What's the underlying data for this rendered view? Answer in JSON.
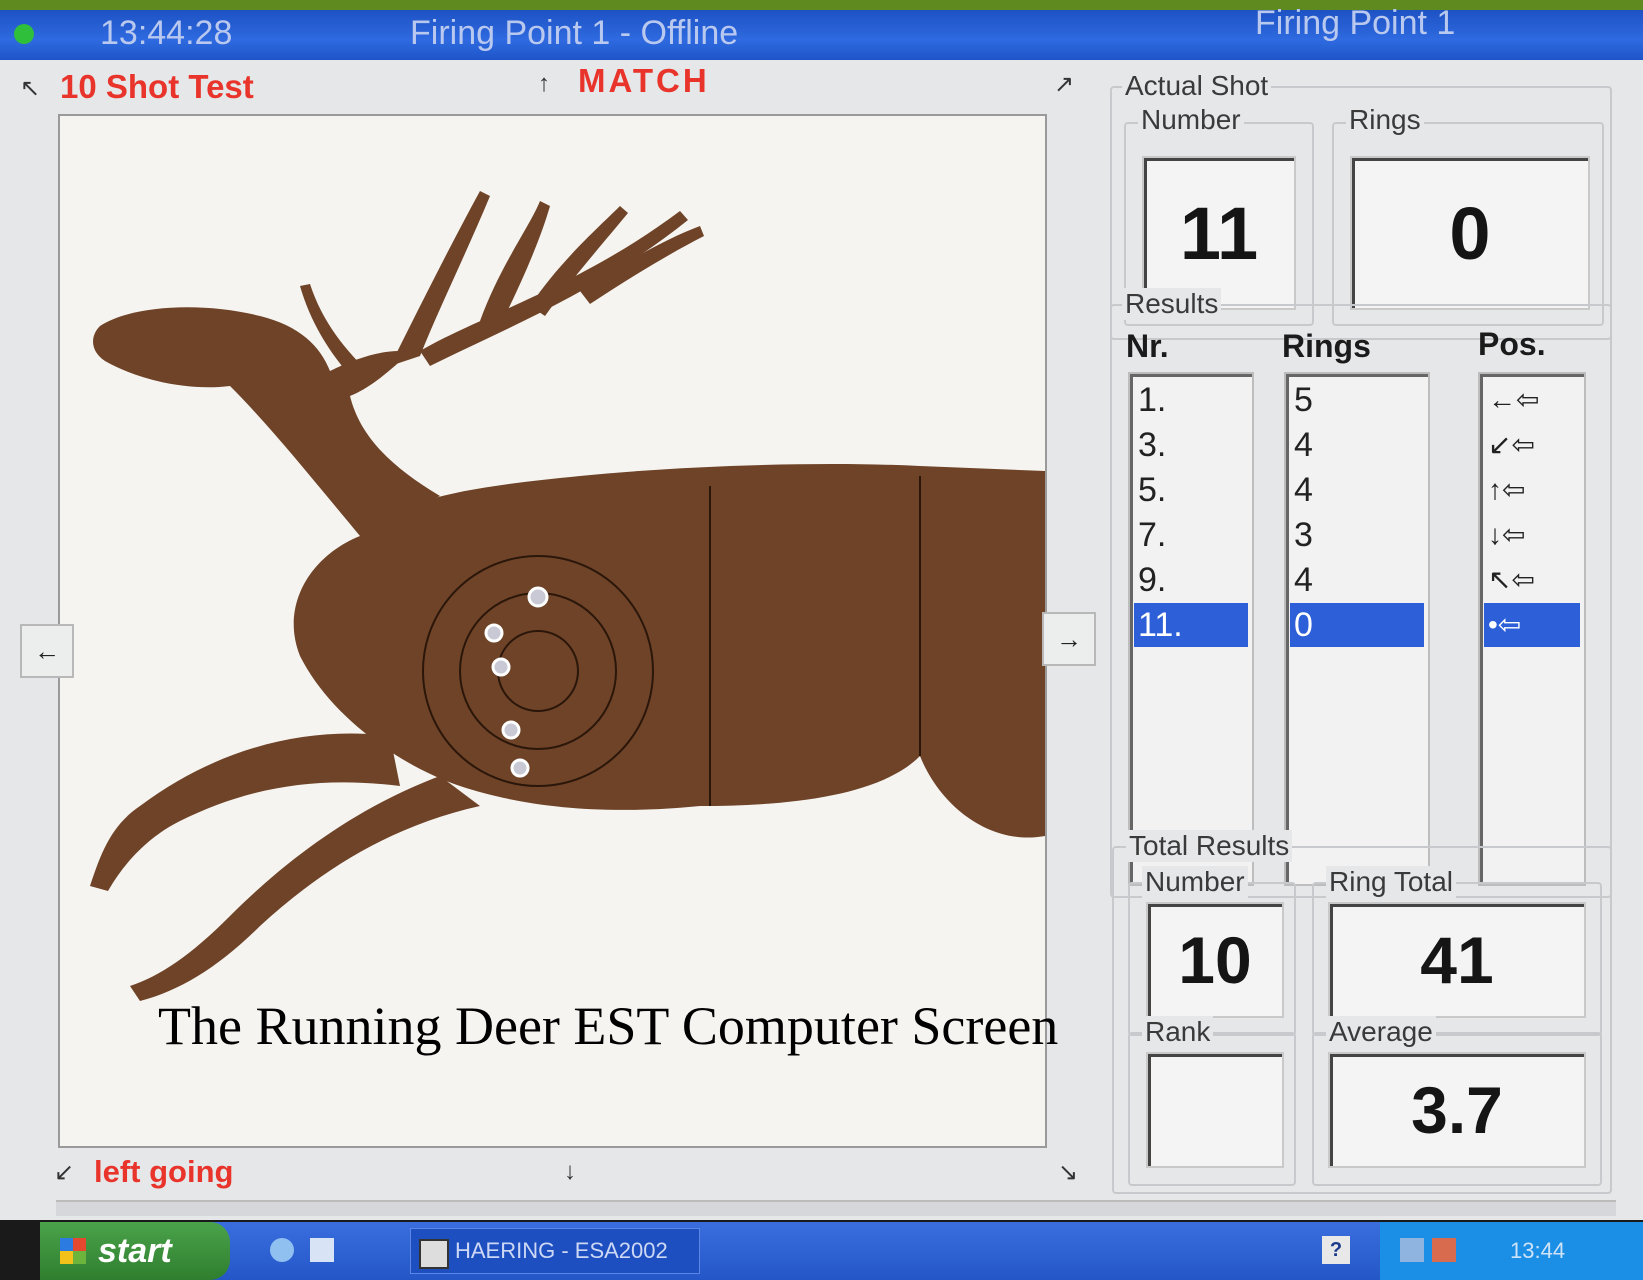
{
  "window": {
    "time": "13:44:28",
    "title": "Firing Point 1 - Offline",
    "right_title": "Firing Point 1"
  },
  "target_panel": {
    "mode": "10 Shot Test",
    "type": "MATCH",
    "direction": "left going",
    "corner_icons": [
      "↖",
      "↑",
      "↗",
      "←",
      "→",
      "↙",
      "↓",
      "↘"
    ]
  },
  "actual_shot": {
    "legend": "Actual Shot",
    "number_label": "Number",
    "number": "11",
    "rings_label": "Rings",
    "rings": "0"
  },
  "results": {
    "legend": "Results",
    "col_nr": "Nr.",
    "col_rings": "Rings",
    "col_pos": "Pos.",
    "rows": [
      {
        "nr": "1.",
        "rings": "5",
        "pos": "←⇦"
      },
      {
        "nr": "3.",
        "rings": "4",
        "pos": "↙⇦"
      },
      {
        "nr": "5.",
        "rings": "4",
        "pos": "↑⇦"
      },
      {
        "nr": "7.",
        "rings": "3",
        "pos": "↓⇦"
      },
      {
        "nr": "9.",
        "rings": "4",
        "pos": "↖⇦"
      },
      {
        "nr": "11.",
        "rings": "0",
        "pos": "•⇦"
      }
    ],
    "selected_index": 5
  },
  "total_results": {
    "legend": "Total Results",
    "number_label": "Number",
    "number": "10",
    "ring_total_label": "Ring Total",
    "ring_total": "41",
    "rank_label": "Rank",
    "rank": "",
    "average_label": "Average",
    "average": "3.7"
  },
  "caption": "The Running Deer EST Computer Screen",
  "taskbar": {
    "start": "start",
    "task": "HAERING - ESA2002",
    "clock": "13:44"
  },
  "colors": {
    "red_text": "#e8342a",
    "title_blue": "#2f6ae0",
    "selection": "#2c5fd8",
    "deer_brown": "#6e4328"
  }
}
